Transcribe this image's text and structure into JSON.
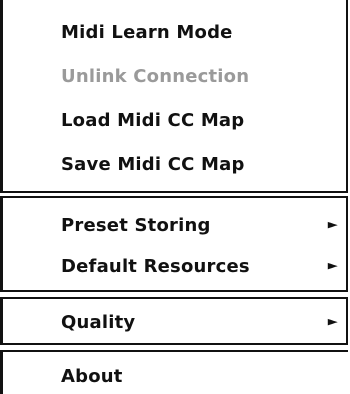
{
  "menu": {
    "sections": [
      {
        "items": [
          {
            "label": "Midi Learn Mode",
            "enabled": true
          },
          {
            "label": "Unlink Connection",
            "enabled": false
          },
          {
            "label": "Load Midi CC Map",
            "enabled": true
          },
          {
            "label": "Save Midi CC Map",
            "enabled": true
          }
        ]
      },
      {
        "items": [
          {
            "label": "Preset Storing",
            "submenu_glyph": "►"
          },
          {
            "label": "Default Resources",
            "submenu_glyph": "►"
          }
        ]
      },
      {
        "items": [
          {
            "label": "Quality",
            "submenu_glyph": "►"
          }
        ]
      },
      {
        "items": [
          {
            "label": "About"
          }
        ]
      }
    ]
  }
}
